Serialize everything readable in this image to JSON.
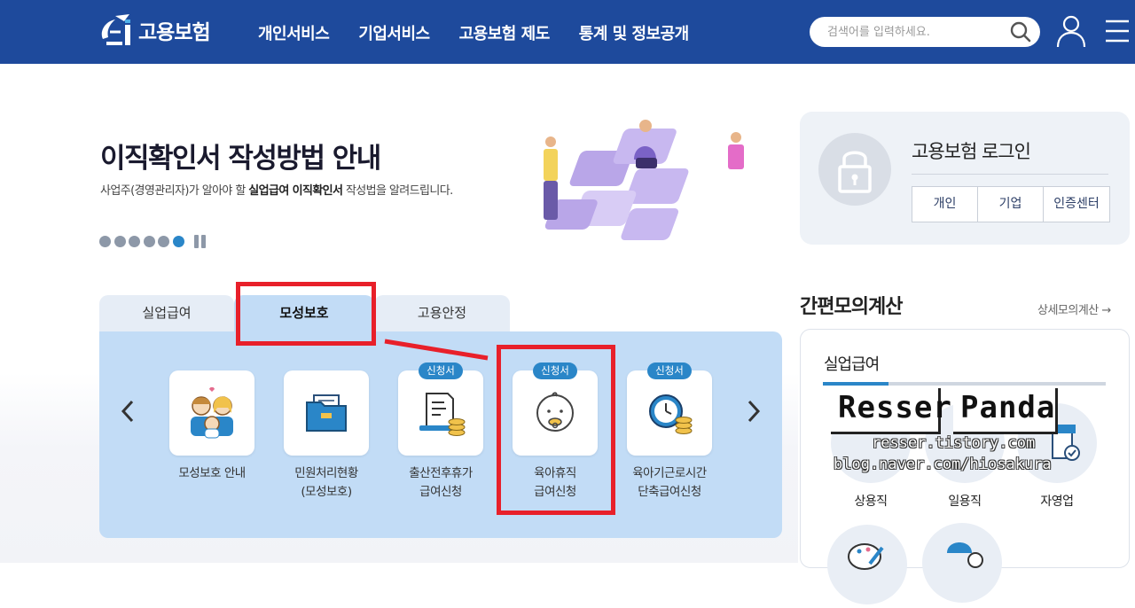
{
  "header": {
    "logo_text": "고용보험",
    "nav": [
      "개인서비스",
      "기업서비스",
      "고용보험 제도",
      "통계 및 정보공개"
    ],
    "search_placeholder": "검색어를 입력하세요."
  },
  "banner": {
    "title": "이직확인서 작성방법 안내",
    "subtitle_prefix": "사업주(경영관리자)가 알아야 할 ",
    "subtitle_bold": "실업급여 이직확인서",
    "subtitle_suffix": " 작성법을 알려드립니다.",
    "slide_count": 6,
    "active_slide": 6
  },
  "login": {
    "title": "고용보험 로그인",
    "tabs": [
      "개인",
      "기업",
      "인증센터"
    ]
  },
  "service_tabs": {
    "tabs": [
      "실업급여",
      "모성보호",
      "고용안정"
    ],
    "active": "모성보호",
    "items": [
      {
        "label1": "모성보호 안내",
        "label2": "",
        "badge": ""
      },
      {
        "label1": "민원처리현황",
        "label2": "(모성보호)",
        "badge": ""
      },
      {
        "label1": "출산전후휴가",
        "label2": "급여신청",
        "badge": "신청서"
      },
      {
        "label1": "육아휴직",
        "label2": "급여신청",
        "badge": "신청서"
      },
      {
        "label1": "육아기근로시간",
        "label2": "단축급여신청",
        "badge": "신청서"
      }
    ]
  },
  "calc": {
    "title": "간편모의계산",
    "more": "상세모의계산 →",
    "tab": "실업급여",
    "items": [
      "상용직",
      "일용직",
      "자영업"
    ]
  },
  "watermark": {
    "word1": "Resser",
    "word2": "Panda",
    "url1": "resser.tistory.com",
    "url2": "blog.naver.com/hiosakura"
  },
  "colors": {
    "header_bg": "#1e4a9c",
    "accent": "#2a86c8",
    "annotation_red": "#e8202a",
    "panel_bg": "#c2dcf6"
  }
}
